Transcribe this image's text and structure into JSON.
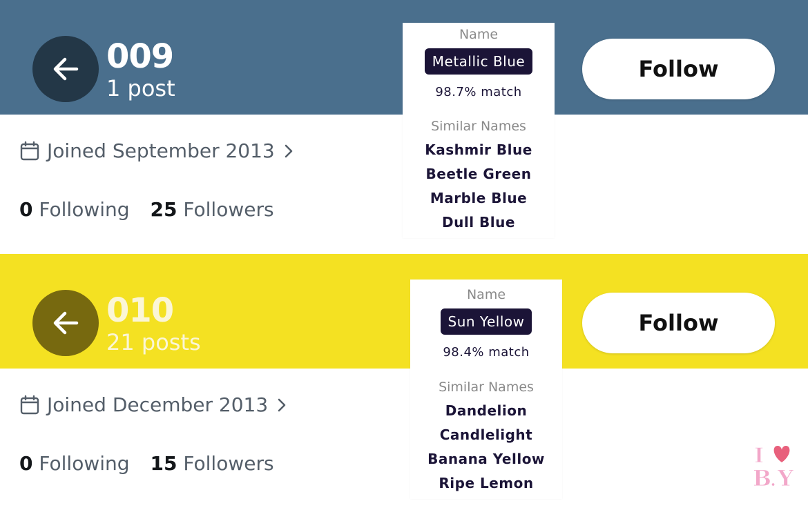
{
  "profiles": [
    {
      "id_number": "009",
      "posts": "1 post",
      "follow_label": "Follow",
      "joined": "Joined September 2013",
      "following_count": "0",
      "following_label": "Following",
      "followers_count": "25",
      "followers_label": "Followers",
      "band_color": "#4a6f8d",
      "back_button_color": "#233747",
      "color_card": {
        "name_label": "Name",
        "color_name": "Metallic Blue",
        "match": "98.7% match",
        "similar_label": "Similar Names",
        "similar": [
          "Kashmir Blue",
          "Beetle Green",
          "Marble Blue",
          "Dull Blue"
        ]
      }
    },
    {
      "id_number": "010",
      "posts": "21 posts",
      "follow_label": "Follow",
      "joined": "Joined December 2013",
      "following_count": "0",
      "following_label": "Following",
      "followers_count": "15",
      "followers_label": "Followers",
      "band_color": "#f4e122",
      "back_button_color": "#77690f",
      "color_card": {
        "name_label": "Name",
        "color_name": "Sun Yellow",
        "match": "98.4% match",
        "similar_label": "Similar Names",
        "similar": [
          "Dandelion",
          "Candlelight",
          "Banana Yellow",
          "Ripe Lemon"
        ]
      }
    }
  ],
  "watermark": {
    "text": "I ♥ B.Y",
    "color": "#f2a7c9",
    "heart_color": "#e8607c"
  },
  "icons": {
    "back": "arrow-left-icon",
    "calendar": "calendar-icon",
    "chevron": "chevron-right-icon"
  }
}
